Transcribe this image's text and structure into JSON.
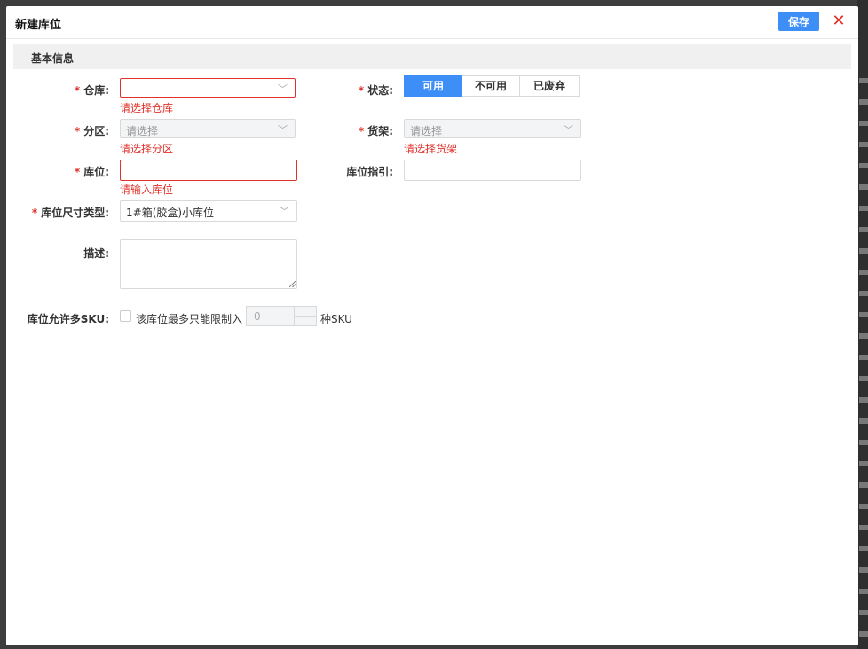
{
  "modal": {
    "title": "新建库位",
    "save_label": "保存",
    "close_glyph": "✕"
  },
  "section": {
    "title": "基本信息"
  },
  "form": {
    "required_mark": "*",
    "warehouse": {
      "label": "仓库:",
      "value": "",
      "error": "请选择仓库"
    },
    "status": {
      "label": "状态:",
      "options": [
        "可用",
        "不可用",
        "已废弃"
      ],
      "selected": "可用"
    },
    "zone": {
      "label": "分区:",
      "placeholder": "请选择",
      "error": "请选择分区"
    },
    "shelf": {
      "label": "货架:",
      "placeholder": "请选择",
      "error": "请选择货架"
    },
    "location": {
      "label": "库位:",
      "value": "",
      "error": "请输入库位"
    },
    "location_guide": {
      "label": "库位指引:",
      "value": ""
    },
    "size_type": {
      "label": "库位尺寸类型:",
      "value": "1#箱(胶盒)小库位"
    },
    "description": {
      "label": "描述:",
      "value": ""
    },
    "multi_sku": {
      "label": "库位允许多SKU:",
      "checkbox_label": "该库位最多只能限制入",
      "checked": false,
      "limit_value": "0",
      "suffix": "种SKU"
    }
  },
  "colors": {
    "accent": "#3d8ef7",
    "error": "#e0322b"
  },
  "icons": {
    "close": "close-icon",
    "dropdown": "chevron-down-icon"
  }
}
